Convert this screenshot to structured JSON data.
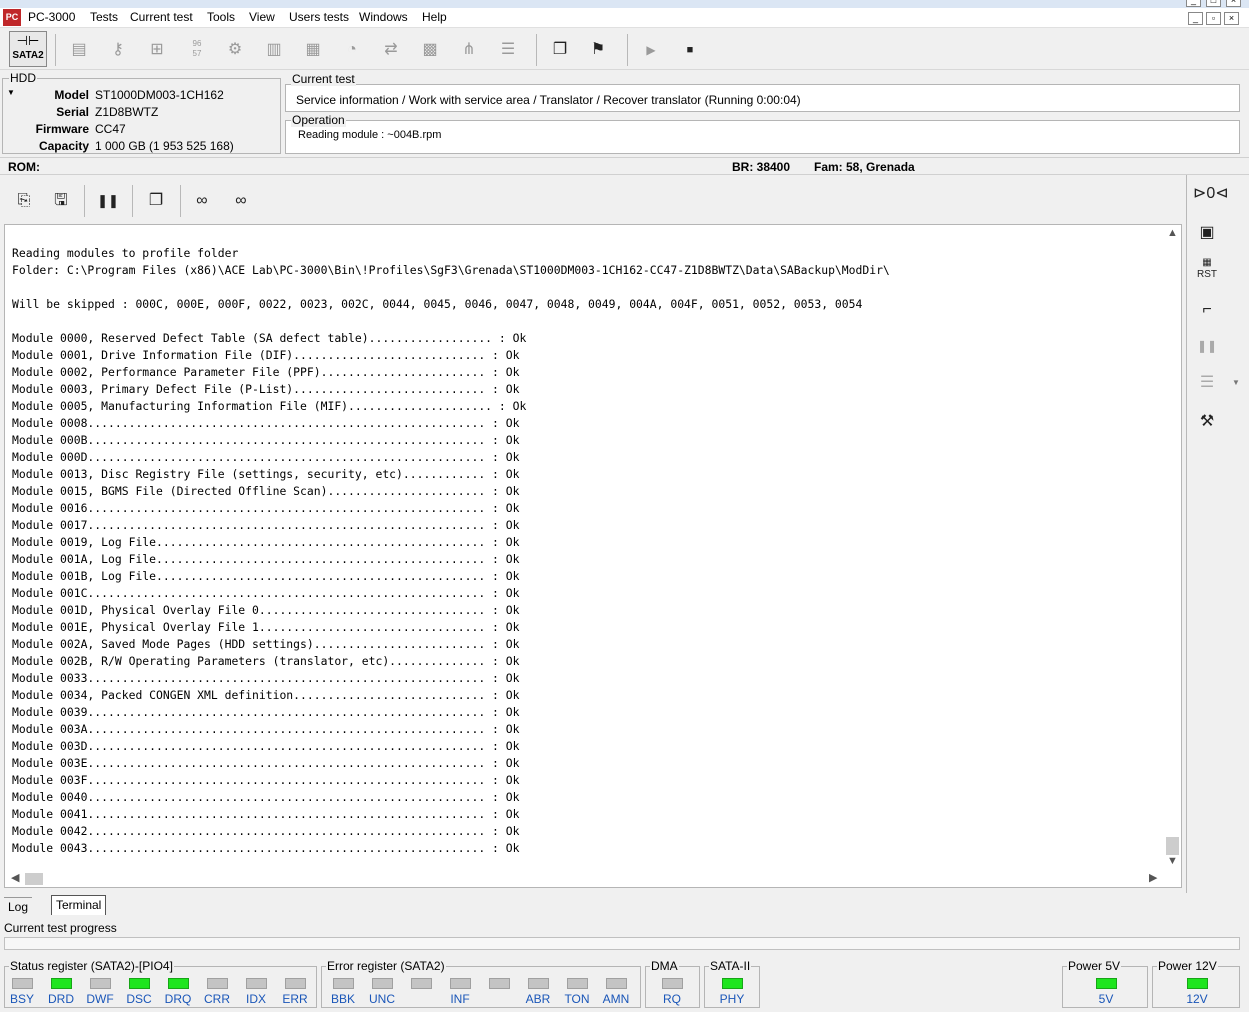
{
  "app": {
    "title": "PC-3000",
    "logo_text": "PC"
  },
  "menu": [
    "Tests",
    "Current test",
    "Tools",
    "View",
    "Users tests",
    "Windows",
    "Help"
  ],
  "toolbar": {
    "sata_label": "SATA2",
    "sata_glyph": "⊣⊢"
  },
  "hdd": {
    "title": "HDD",
    "model_label": "Model",
    "model": "ST1000DM003-1CH162",
    "serial_label": "Serial",
    "serial": "Z1D8BWTZ",
    "firmware_label": "Firmware",
    "firmware": "CC47",
    "capacity_label": "Capacity",
    "capacity": "1 000 GB (1 953 525 168)"
  },
  "current_test": {
    "title": "Current test",
    "text": "Service information / Work with service area / Translator / Recover translator (Running 0:00:04)"
  },
  "operation": {
    "title": "Operation",
    "text": "Reading module : ~004B.rpm"
  },
  "rombar": {
    "rom": "ROM:",
    "br": "BR: 38400",
    "fam": "Fam: 58, Grenada"
  },
  "log": {
    "lines": [
      "Reading modules to profile folder",
      "Folder: C:\\Program Files (x86)\\ACE Lab\\PC-3000\\Bin\\!Profiles\\SgF3\\Grenada\\ST1000DM003-1CH162-CC47-Z1D8BWTZ\\Data\\SABackup\\ModDir\\",
      "",
      "Will be skipped : 000C, 000E, 000F, 0022, 0023, 002C, 0044, 0045, 0046, 0047, 0048, 0049, 004A, 004F, 0051, 0052, 0053, 0054",
      "",
      "Module 0000, Reserved Defect Table (SA defect table).................. : Ok",
      "Module 0001, Drive Information File (DIF)............................ : Ok",
      "Module 0002, Performance Parameter File (PPF)........................ : Ok",
      "Module 0003, Primary Defect File (P-List)............................ : Ok",
      "Module 0005, Manufacturing Information File (MIF)..................... : Ok",
      "Module 0008.......................................................... : Ok",
      "Module 000B.......................................................... : Ok",
      "Module 000D.......................................................... : Ok",
      "Module 0013, Disc Registry File (settings, security, etc)............ : Ok",
      "Module 0015, BGMS File (Directed Offline Scan)....................... : Ok",
      "Module 0016.......................................................... : Ok",
      "Module 0017.......................................................... : Ok",
      "Module 0019, Log File................................................ : Ok",
      "Module 001A, Log File................................................ : Ok",
      "Module 001B, Log File................................................ : Ok",
      "Module 001C.......................................................... : Ok",
      "Module 001D, Physical Overlay File 0................................. : Ok",
      "Module 001E, Physical Overlay File 1................................. : Ok",
      "Module 002A, Saved Mode Pages (HDD settings)......................... : Ok",
      "Module 002B, R/W Operating Parameters (translator, etc).............. : Ok",
      "Module 0033.......................................................... : Ok",
      "Module 0034, Packed CONGEN XML definition............................ : Ok",
      "Module 0039.......................................................... : Ok",
      "Module 003A.......................................................... : Ok",
      "Module 003D.......................................................... : Ok",
      "Module 003E.......................................................... : Ok",
      "Module 003F.......................................................... : Ok",
      "Module 0040.......................................................... : Ok",
      "Module 0041.......................................................... : Ok",
      "Module 0042.......................................................... : Ok",
      "Module 0043.......................................................... : Ok"
    ]
  },
  "tabs": {
    "log": "Log",
    "terminal": "Terminal"
  },
  "progress": {
    "label": "Current test progress",
    "value": 0
  },
  "status_register": {
    "title": "Status register (SATA2)-[PIO4]",
    "flags": [
      {
        "label": "BSY",
        "on": false
      },
      {
        "label": "DRD",
        "on": true
      },
      {
        "label": "DWF",
        "on": false
      },
      {
        "label": "DSC",
        "on": true
      },
      {
        "label": "DRQ",
        "on": true
      },
      {
        "label": "CRR",
        "on": false
      },
      {
        "label": "IDX",
        "on": false
      },
      {
        "label": "ERR",
        "on": false
      }
    ]
  },
  "error_register": {
    "title": "Error register (SATA2)",
    "flags": [
      {
        "label": "BBK",
        "on": false
      },
      {
        "label": "UNC",
        "on": false
      },
      {
        "label": "",
        "on": false
      },
      {
        "label": "INF",
        "on": false
      },
      {
        "label": "",
        "on": false
      },
      {
        "label": "ABR",
        "on": false
      },
      {
        "label": "TON",
        "on": false
      },
      {
        "label": "AMN",
        "on": false
      }
    ]
  },
  "dma": {
    "title": "DMA",
    "flags": [
      {
        "label": "RQ",
        "on": false
      }
    ]
  },
  "sata2": {
    "title": "SATA-II",
    "flags": [
      {
        "label": "PHY",
        "on": true
      }
    ]
  },
  "power5": {
    "title": "Power 5V",
    "flags": [
      {
        "label": "5V",
        "on": true
      }
    ]
  },
  "power12": {
    "title": "Power 12V",
    "flags": [
      {
        "label": "12V",
        "on": true
      }
    ]
  },
  "colors": {
    "led_on": "#1ee51e",
    "led_off": "#c4c4c4",
    "reg_label": "#1a56b8"
  },
  "icons": {
    "toolbar": [
      "sata-port-icon",
      "report-icon",
      "key-icon",
      "network-icon",
      "baud-rate-icon",
      "gear-icon",
      "chip-icon",
      "hdd-map-icon",
      "disk-icon",
      "translator-icon",
      "grid-icon",
      "tree-icon",
      "list-icon",
      "copy-windows-icon",
      "exit-run-icon",
      "play-icon",
      "stop-icon"
    ],
    "inner": [
      "open-module-icon",
      "save-module-icon",
      "pause-icon",
      "copy-icon",
      "find-icon",
      "find-next-icon"
    ],
    "side": [
      "power-icon",
      "sa-module-icon",
      "reset-icon",
      "pcb-icon",
      "pause-icon",
      "settings-icon",
      "tools-icon"
    ]
  }
}
